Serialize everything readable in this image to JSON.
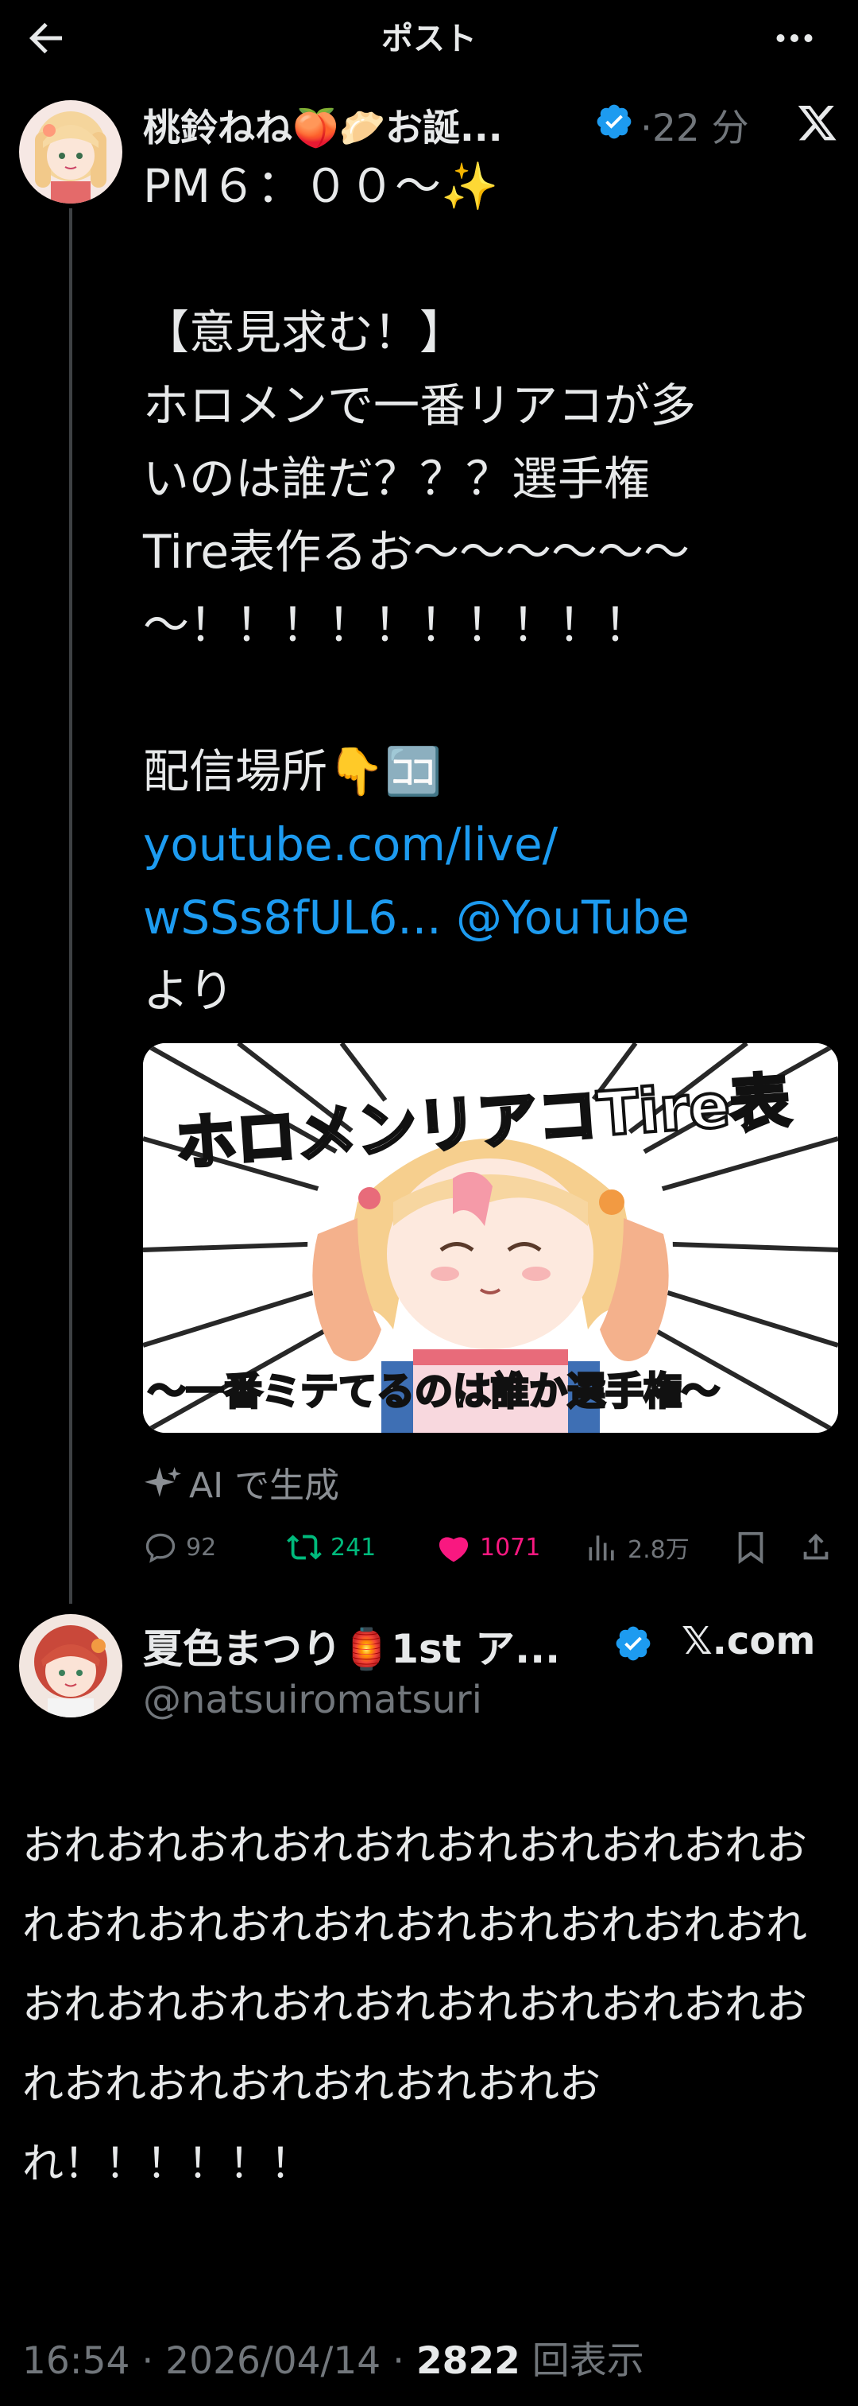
{
  "header": {
    "title": "ポスト",
    "back_icon": "arrow-left-icon",
    "more_icon": "more-horizontal-icon"
  },
  "post": {
    "author_name": "桃鈴ねね🍑🥟お誕...",
    "verified_icon": "verified-badge-icon",
    "time": "·22 分",
    "x_icon": "x-logo-icon",
    "text_lines": [
      "PM６：００〜✨",
      "",
      "【意見求む！】",
      "ホロメンで一番リアコが多",
      "いのは誰だ？？？選手権",
      "Tire表作るお〜〜〜〜〜〜",
      "〜！！！！！！！！！！",
      "",
      "配信場所👇🈁"
    ],
    "link_1": "youtube.com/live/",
    "link_2": "wSSs8fUL6...",
    "mention": "@YouTube",
    "text_tail": "より",
    "media": {
      "title": "ホロメンリアコTire表",
      "subtitle": "〜一番ミテてるのは誰か選手権〜"
    },
    "ai_label": "AI で生成",
    "actions": {
      "replies": "92",
      "reposts": "241",
      "likes": "1071",
      "views": "2.8万"
    },
    "colors": {
      "repost": "#00ba7c",
      "like": "#f91880",
      "link": "#1d9bf0"
    }
  },
  "reply": {
    "author_name": "夏色まつり🏮1st ア...",
    "verified_icon": "verified-badge-icon",
    "source": "𝕏.com",
    "handle": "@natsuiromatsuri",
    "text": "おれおれおれおれおれおれおれおれおれおれおれおれおれおれおれおれおれおれおれおれおれおれおれおれおれおれおれおれおれおれおれおれおれおれおれおれ！！！！！！"
  },
  "meta": {
    "time": "16:54 · 2026/04/14 · ",
    "views_count": "2822",
    "views_label": " 回表示"
  }
}
